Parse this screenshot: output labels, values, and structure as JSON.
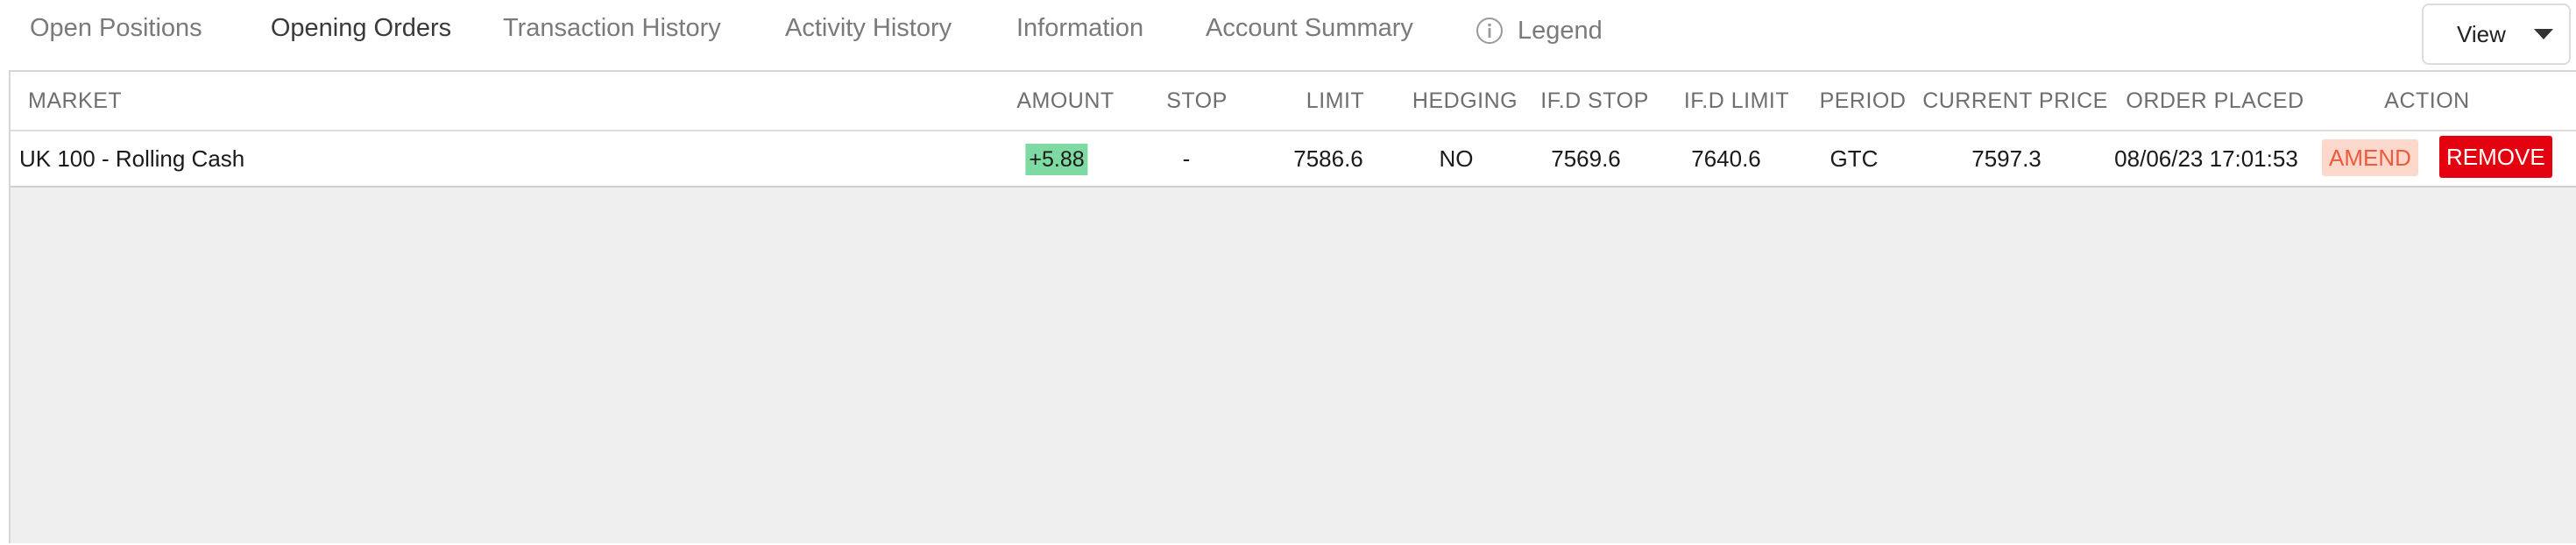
{
  "tabs": [
    {
      "label": "Open Positions",
      "active": false
    },
    {
      "label": "Opening Orders",
      "active": true
    },
    {
      "label": "Transaction History",
      "active": false
    },
    {
      "label": "Activity History",
      "active": false
    },
    {
      "label": "Information",
      "active": false
    },
    {
      "label": "Account Summary",
      "active": false
    }
  ],
  "legend": {
    "label": "Legend",
    "icon": "info-icon"
  },
  "view_button": {
    "label": "View",
    "icon": "chevron-down-icon"
  },
  "table": {
    "headers": {
      "market": "MARKET",
      "amount": "AMOUNT",
      "stop": "STOP",
      "limit": "LIMIT",
      "hedging": "HEDGING",
      "ifd_stop": "IF.D STOP",
      "ifd_limit": "IF.D LIMIT",
      "period": "PERIOD",
      "current_price": "CURRENT PRICE",
      "order_placed": "ORDER PLACED",
      "action": "ACTION"
    },
    "rows": [
      {
        "market": "UK 100 - Rolling Cash",
        "amount": "+5.88",
        "stop": "-",
        "limit": "7586.6",
        "hedging": "NO",
        "ifd_stop": "7569.6",
        "ifd_limit": "7640.6",
        "period": "GTC",
        "current_price": "7597.3",
        "order_placed": "08/06/23 17:01:53",
        "amend_label": "AMEND",
        "remove_label": "REMOVE"
      }
    ]
  },
  "colors": {
    "active_tab_underline": "#e8796a",
    "amount_positive_bg": "#7fd9a2",
    "amend_bg": "#fbd7cc",
    "amend_text": "#ef5a3c",
    "remove_bg": "#e3000f",
    "panel_bg": "#efefef"
  }
}
